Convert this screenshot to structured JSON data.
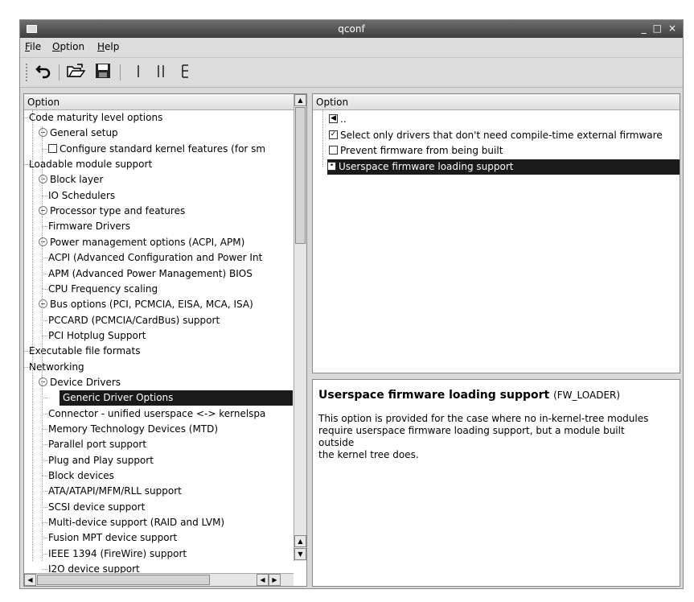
{
  "window": {
    "title": "qconf",
    "controls": [
      "_",
      "□",
      "×"
    ]
  },
  "menubar": [
    {
      "label": "File",
      "accel": "F",
      "rest": "ile"
    },
    {
      "label": "Option",
      "accel": "O",
      "rest": "ption"
    },
    {
      "label": "Help",
      "accel": "H",
      "rest": "elp"
    }
  ],
  "toolbar": {
    "buttons": [
      {
        "name": "back-button",
        "icon": "undo-arrow-icon",
        "glyph": "↶"
      },
      {
        "name": "load-button",
        "icon": "open-folder-icon",
        "glyph": "📂"
      },
      {
        "name": "save-button",
        "icon": "floppy-disk-icon",
        "glyph": "💾"
      },
      {
        "name": "single-view-button",
        "icon": "single-view-icon",
        "glyph": "|"
      },
      {
        "name": "split-view-button",
        "icon": "split-view-icon",
        "glyph": "||"
      },
      {
        "name": "full-view-button",
        "icon": "full-view-icon",
        "glyph": "E"
      }
    ]
  },
  "left_panel": {
    "header": "Option",
    "items": [
      {
        "label": "Code maturity level options",
        "level": 1,
        "expander": ""
      },
      {
        "label": "General setup",
        "level": 0,
        "expander": "⊖"
      },
      {
        "label": "Configure standard kernel features (for sm",
        "level": 2,
        "checkbox": ""
      },
      {
        "label": "Loadable module support",
        "level": 1,
        "expander": ""
      },
      {
        "label": "Block layer",
        "level": 0,
        "expander": "⊖"
      },
      {
        "label": "IO Schedulers",
        "level": 2
      },
      {
        "label": "Processor type and features",
        "level": 0,
        "expander": "⊖"
      },
      {
        "label": "Firmware Drivers",
        "level": 2
      },
      {
        "label": "Power management options (ACPI, APM)",
        "level": 0,
        "expander": "⊖"
      },
      {
        "label": "ACPI (Advanced Configuration and Power Int",
        "level": 2
      },
      {
        "label": "APM (Advanced Power Management) BIOS",
        "level": 2
      },
      {
        "label": "CPU Frequency scaling",
        "level": 2
      },
      {
        "label": "Bus options (PCI, PCMCIA, EISA, MCA, ISA)",
        "level": 0,
        "expander": "⊖"
      },
      {
        "label": "PCCARD (PCMCIA/CardBus) support",
        "level": 2
      },
      {
        "label": "PCI Hotplug Support",
        "level": 2
      },
      {
        "label": "Executable file formats",
        "level": 1
      },
      {
        "label": "Networking",
        "level": 1
      },
      {
        "label": "Device Drivers",
        "level": 0,
        "expander": "⊖"
      },
      {
        "label": "Generic Driver Options",
        "level": 2,
        "selected": true
      },
      {
        "label": "Connector - unified userspace <-> kernelspa",
        "level": 2
      },
      {
        "label": "Memory Technology Devices (MTD)",
        "level": 2
      },
      {
        "label": "Parallel port support",
        "level": 2
      },
      {
        "label": "Plug and Play support",
        "level": 2
      },
      {
        "label": "Block devices",
        "level": 2
      },
      {
        "label": "ATA/ATAPI/MFM/RLL support",
        "level": 2
      },
      {
        "label": "SCSI device support",
        "level": 2
      },
      {
        "label": "Multi-device support (RAID and LVM)",
        "level": 2
      },
      {
        "label": "Fusion MPT device support",
        "level": 2
      },
      {
        "label": "IEEE 1394 (FireWire) support",
        "level": 2
      },
      {
        "label": "I2O device support",
        "level": 2
      }
    ]
  },
  "right_panel": {
    "header": "Option",
    "items": [
      {
        "label": "..",
        "kind": "back",
        "mark": "◀"
      },
      {
        "label": "Select only drivers that don't need compile-time external firmware",
        "kind": "checkbox",
        "mark": "✓"
      },
      {
        "label": "Prevent firmware from being built",
        "kind": "checkbox",
        "mark": ""
      },
      {
        "label": "Userspace firmware loading support",
        "kind": "tristate",
        "mark": "•",
        "selected": true
      }
    ]
  },
  "help": {
    "title": "Userspace firmware loading support",
    "symbol": "(FW_LOADER)",
    "lines": [
      "This option is provided for the case where no in-kernel-tree modules",
      "require userspace firmware loading support, but a module built",
      "outside",
      "the kernel tree does."
    ]
  },
  "colors": {
    "selection": "#1a1a1a",
    "titlebar": "#4a4a4a",
    "chrome": "#dcdcdc"
  }
}
